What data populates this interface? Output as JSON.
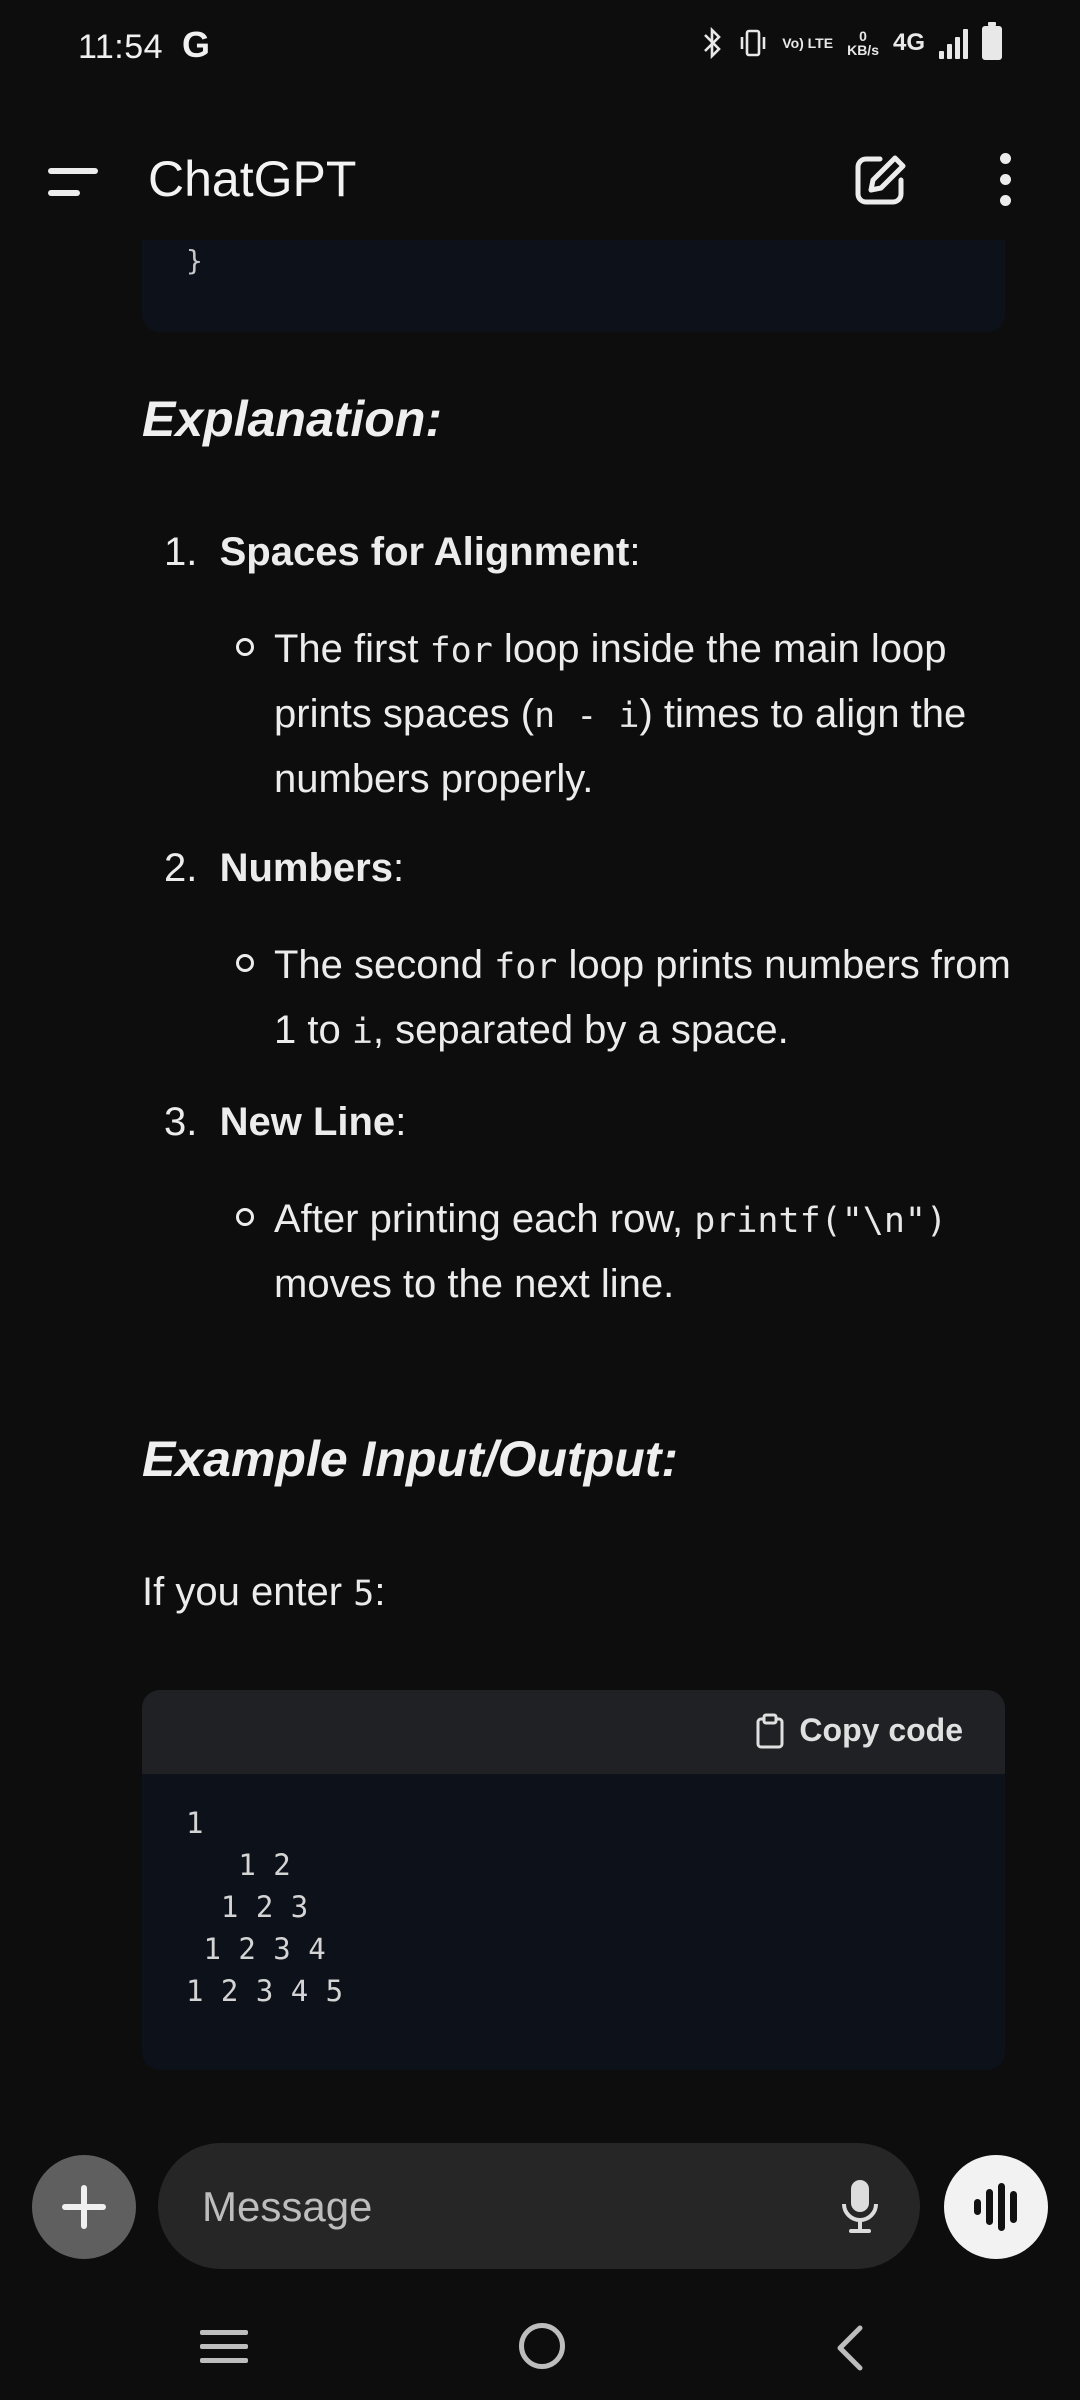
{
  "status_bar": {
    "time": "11:54",
    "g_icon": "G",
    "volte": "Vo) LTE",
    "speed_value": "0",
    "speed_unit": "KB/s",
    "network": "4G"
  },
  "app_bar": {
    "title": "ChatGPT"
  },
  "message": {
    "code_tail": "}",
    "explanation_heading": "Explanation:",
    "items": [
      {
        "number": "1.",
        "title": "Spaces for Alignment",
        "bullet_parts": [
          "The first ",
          "for",
          " loop inside the main loop prints spaces (",
          "n - i",
          ") times to align the numbers properly."
        ]
      },
      {
        "number": "2.",
        "title": "Numbers",
        "bullet_parts": [
          "The second ",
          "for",
          " loop prints numbers from 1 to ",
          "i",
          ", separated by a space."
        ]
      },
      {
        "number": "3.",
        "title": "New Line",
        "bullet_parts": [
          "After printing each row, ",
          "printf(\"\\n\")",
          " moves to the next line."
        ]
      }
    ],
    "example_heading": "Example Input/Output:",
    "input_prefix": "If you enter ",
    "input_value": "5",
    "input_suffix": ":",
    "code_block": {
      "copy_label": "Copy code",
      "code": "1\n   1 2\n  1 2 3\n 1 2 3 4\n1 2 3 4 5"
    }
  },
  "composer": {
    "placeholder": "Message"
  },
  "icons": {
    "menu": "menu-icon",
    "compose": "compose-icon",
    "more": "more-vertical-icon",
    "clipboard": "clipboard-icon",
    "plus": "plus-icon",
    "mic": "microphone-icon",
    "voice": "voice-mode-icon"
  },
  "colors": {
    "background": "#0d0d0d",
    "code_background": "#0c111a",
    "code_header": "#202124",
    "composer_background": "#262626"
  }
}
